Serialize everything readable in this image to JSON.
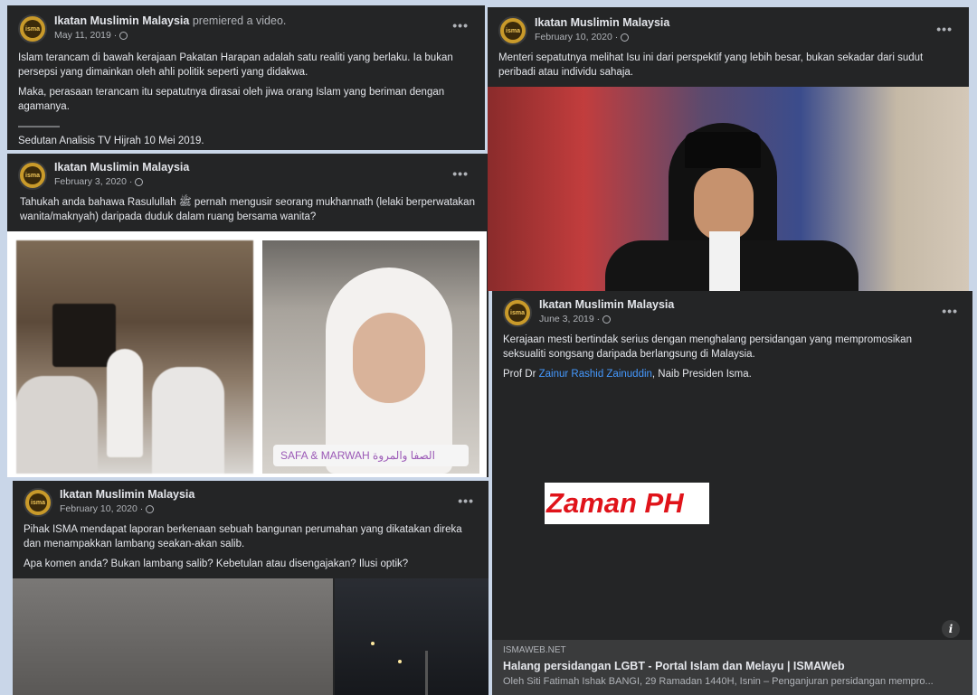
{
  "author": "Ikatan Muslimin Malaysia",
  "avatar_text": "isma",
  "more_icon": "more-horizontal-icon",
  "globe_icon": "globe-icon",
  "post1": {
    "action": "premiered a video.",
    "date": "May 11, 2019 ·",
    "p1": "Islam terancam di bawah kerajaan Pakatan Harapan adalah satu realiti yang berlaku. Ia bukan persepsi yang dimainkan oleh ahli politik seperti yang didakwa.",
    "p2": "Maka, perasaan terancam itu sepatutnya dirasai oleh jiwa orang Islam yang beriman dengan agamanya.",
    "divider": "————",
    "p3": "Sedutan Analisis TV Hijrah 10 Mei 2019."
  },
  "post2": {
    "date": "February 3, 2020 ·",
    "p1": "Tahukah anda bahawa Rasulullah ﷺ pernah mengusir seorang mukhannath (lelaki berperwatakan wanita/maknyah) daripada duduk dalam ruang bersama wanita?",
    "tag": "SAFA & MARWAH  الصفا والمروة"
  },
  "post3": {
    "date": "February 10, 2020 ·",
    "p1": "Menteri sepatutnya melihat Isu ini dari perspektif yang lebih besar, bukan sekadar dari sudut peribadi atau individu sahaja."
  },
  "post4": {
    "date": "February 10, 2020 ·",
    "p1": "Pihak ISMA mendapat laporan berkenaan sebuah bangunan perumahan yang dikatakan direka dan menampakkan lambang seakan-akan salib.",
    "p2": "Apa komen anda? Bukan lambang salib? Kebetulan atau disengajakan? Ilusi optik?"
  },
  "post5": {
    "date": "June 3, 2019 ·",
    "p1": "Kerajaan mesti bertindak serius dengan menghalang persidangan yang mempromosikan seksualiti songsang daripada berlangsung di Malaysia.",
    "p2_prefix": "Prof Dr ",
    "p2_link": "Zainur Rashid Zainuddin",
    "p2_suffix": ", Naib Presiden Isma.",
    "overlay": "Zaman PH",
    "info_icon": "i",
    "link_domain": "ISMAWEB.NET",
    "link_title": "Halang persidangan LGBT - Portal Islam dan Melayu | ISMAWeb",
    "link_desc": "Oleh Siti Fatimah Ishak BANGI, 29 Ramadan 1440H, Isnin – Penganjuran persidangan mempro..."
  }
}
